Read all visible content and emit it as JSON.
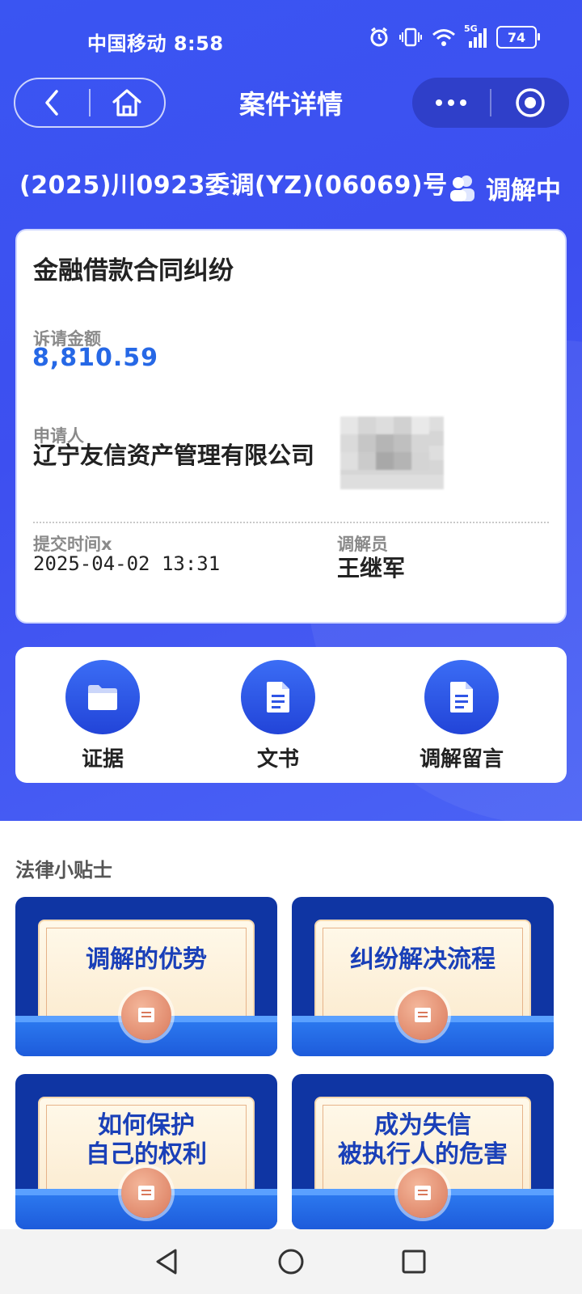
{
  "status_bar": {
    "carrier": "中国移动",
    "time": "8:58",
    "network": "5G",
    "battery": "74"
  },
  "nav": {
    "title": "案件详情"
  },
  "case": {
    "number": "(2025)川0923委调(YZ)(06069)号",
    "status": "调解中",
    "type": "金融借款合同纠纷",
    "amount_label": "诉请金额",
    "amount": "8,810.59",
    "applicant_label": "申请人",
    "applicant": "辽宁友信资产管理有限公司",
    "submit_label": "提交时间x",
    "submit_time": "2025-04-02 13:31",
    "mediator_label": "调解员",
    "mediator": "王继军"
  },
  "actions": [
    {
      "label": "证据",
      "icon": "folder-icon"
    },
    {
      "label": "文书",
      "icon": "document-icon"
    },
    {
      "label": "调解留言",
      "icon": "document-icon"
    }
  ],
  "tips": {
    "title": "法律小贴士",
    "items": [
      {
        "text": "调解的优势"
      },
      {
        "text": "纠纷解决流程"
      },
      {
        "line1": "如何保护",
        "line2": "自己的权利"
      },
      {
        "line1": "成为失信",
        "line2": "被执行人的危害"
      }
    ]
  },
  "colors": {
    "brand_blue": "#3d4ff0",
    "amount_blue": "#2668e6",
    "tip_blue": "#1a40b8"
  }
}
